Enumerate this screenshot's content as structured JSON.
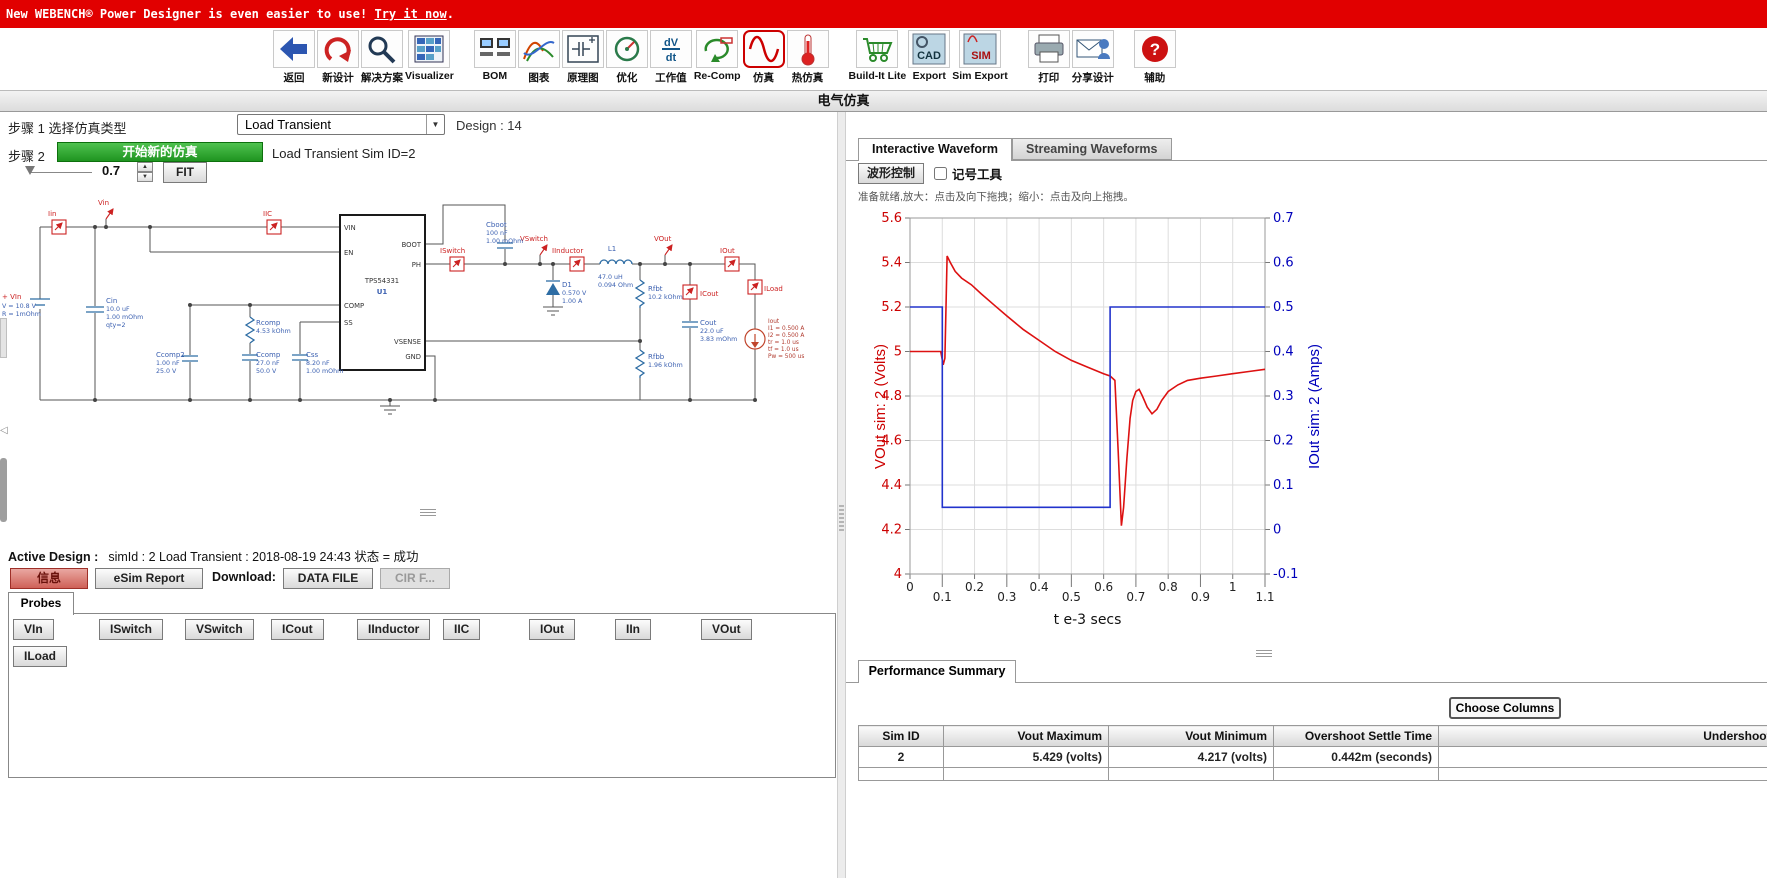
{
  "banner": {
    "prefix": "New WEBENCH® Power Designer is even easier to use! ",
    "link": "Try it now",
    "suffix": "."
  },
  "toolbar": {
    "items": [
      {
        "label": "返回",
        "icon": "back-arrow"
      },
      {
        "label": "新设计",
        "icon": "new-design-arrow"
      },
      {
        "label": "解决方案",
        "icon": "magnifier"
      },
      {
        "label": "Visualizer",
        "icon": "visualizer-grid"
      },
      {
        "label": "BOM",
        "icon": "bom"
      },
      {
        "label": "图表",
        "icon": "charts-curves"
      },
      {
        "label": "原理图",
        "icon": "schematic"
      },
      {
        "label": "优化",
        "icon": "optimize-dial"
      },
      {
        "label": "工作值",
        "icon": "dvdt"
      },
      {
        "label": "Re-Comp",
        "icon": "recomp"
      },
      {
        "label": "仿真",
        "icon": "sine-wave",
        "active": true
      },
      {
        "label": "热仿真",
        "icon": "thermometer"
      },
      {
        "label": "Build-It Lite",
        "icon": "shopping-cart"
      },
      {
        "label": "Export",
        "icon": "cad-export"
      },
      {
        "label": "Sim Export",
        "icon": "sim-export"
      },
      {
        "label": "打印",
        "icon": "printer"
      },
      {
        "label": "分享设计",
        "icon": "share-mail"
      },
      {
        "label": "辅助",
        "icon": "help"
      }
    ]
  },
  "section_bar": {
    "title": "电气仿真"
  },
  "steps": {
    "step1_label": "步骤 1 选择仿真类型",
    "sim_type": "Load Transient",
    "design_label": "Design : 14",
    "step2_label": "步骤 2",
    "start_button": "开始新的仿真",
    "sim_info": "Load Transient Sim ID=2",
    "slider_value": "0.7",
    "fit_button": "FIT"
  },
  "schematic": {
    "ic": {
      "part": "TPS54331",
      "ref": "U1",
      "pins_left": [
        "VIN",
        "EN",
        "COMP",
        "SS"
      ],
      "pins_right": [
        "BOOT",
        "PH",
        "VSENSE",
        "GND"
      ]
    },
    "probes": {
      "iin": "Iin",
      "vin": "Vin",
      "iic": "IIC",
      "iswitch": "ISwitch",
      "vswitch": "VSwitch",
      "iinductor": "IInductor",
      "vout": "VOut",
      "iout": "IOut",
      "icout": "ICout",
      "iload": "ILoad"
    },
    "components": {
      "vin_src": [
        "+ VIn",
        "V = 10.8 V",
        "R = 1mOhm"
      ],
      "cin": [
        "Cin",
        "10.0 uF",
        "1.00 mOhm",
        "qty=2"
      ],
      "ccomp2": [
        "Ccomp2",
        "1.00 nF",
        "25.0 V"
      ],
      "rcomp": [
        "Rcomp",
        "4.53 kOhm"
      ],
      "ccomp": [
        "Ccomp",
        "27.0 nF",
        "50.0 V"
      ],
      "css": [
        "Css",
        "8.20 nF",
        "1.00 mOhm"
      ],
      "cboot": [
        "Cboot",
        "100 nF",
        "1.00 mOhm"
      ],
      "d1": [
        "D1",
        "0.570 V",
        "1.00 A"
      ],
      "l1": [
        "L1",
        "47.0 uH",
        "0.094 Ohm"
      ],
      "rfbt": [
        "Rfbt",
        "10.2 kOhm"
      ],
      "cout": [
        "Cout",
        "22.0 uF",
        "3.83 mOhm"
      ],
      "rfbb": [
        "Rfbb",
        "1.96 kOhm"
      ],
      "iout_src": [
        "Iout",
        "I1 = 0.500 A",
        "I2 = 0.500 A",
        "tr = 1.0 us",
        "tf = 1.0 us",
        "Pw = 500 us"
      ]
    }
  },
  "active_design": {
    "label": "Active Design :",
    "value": "simId : 2 Load Transient : 2018-08-19 24:43 状态 = 成功"
  },
  "actions": {
    "info": "信息",
    "esim_report": "eSim Report",
    "download_label": "Download:",
    "data_file": "DATA FILE",
    "cir_file": "CIR F..."
  },
  "probes_panel": {
    "tab": "Probes",
    "buttons": [
      "VIn",
      "ISwitch",
      "VSwitch",
      "ICout",
      "IInductor",
      "IIC",
      "IOut",
      "IIn",
      "VOut",
      "ILoad"
    ]
  },
  "waveform_panel": {
    "tabs": [
      "Interactive Waveform",
      "Streaming Waveforms"
    ],
    "control_button": "波形控制",
    "marker_checkbox": "记号工具",
    "status_text": "准备就绪,放大：点击及向下拖拽；缩小：点击及向上拖拽。"
  },
  "chart_data": {
    "type": "line",
    "title": "",
    "xlabel": "t e-3 secs",
    "xlim": [
      0,
      1.1
    ],
    "xticks": [
      0,
      0.1,
      0.2,
      0.3,
      0.4,
      0.5,
      0.6,
      0.7,
      0.8,
      0.9,
      1,
      1.1
    ],
    "grid": true,
    "legend": "none",
    "left_axis": {
      "label": "VOut sim: 2 (Volts)",
      "color": "#cc0000",
      "lim": [
        4,
        5.6
      ],
      "ticks": [
        4,
        4.2,
        4.4,
        4.6,
        4.8,
        5,
        5.2,
        5.4,
        5.6
      ]
    },
    "right_axis": {
      "label": "IOut sim: 2 (Amps)",
      "color": "#0000bb",
      "lim": [
        -0.1,
        0.7
      ],
      "ticks": [
        -0.1,
        0,
        0.1,
        0.2,
        0.3,
        0.4,
        0.5,
        0.6,
        0.7
      ]
    },
    "series": [
      {
        "name": "VOut sim: 2",
        "axis": "left",
        "color": "#dd1111",
        "points": [
          [
            0,
            5
          ],
          [
            0.095,
            5
          ],
          [
            0.103,
            4.94
          ],
          [
            0.108,
            4.97
          ],
          [
            0.115,
            5.429
          ],
          [
            0.125,
            5.4
          ],
          [
            0.14,
            5.36
          ],
          [
            0.16,
            5.33
          ],
          [
            0.19,
            5.3
          ],
          [
            0.22,
            5.26
          ],
          [
            0.26,
            5.21
          ],
          [
            0.3,
            5.16
          ],
          [
            0.35,
            5.1
          ],
          [
            0.4,
            5.05
          ],
          [
            0.45,
            5
          ],
          [
            0.5,
            4.96
          ],
          [
            0.55,
            4.93
          ],
          [
            0.6,
            4.9
          ],
          [
            0.62,
            4.89
          ],
          [
            0.635,
            4.87
          ],
          [
            0.645,
            4.55
          ],
          [
            0.655,
            4.217
          ],
          [
            0.662,
            4.3
          ],
          [
            0.672,
            4.52
          ],
          [
            0.682,
            4.7
          ],
          [
            0.69,
            4.78
          ],
          [
            0.7,
            4.82
          ],
          [
            0.71,
            4.83
          ],
          [
            0.72,
            4.8
          ],
          [
            0.735,
            4.75
          ],
          [
            0.75,
            4.72
          ],
          [
            0.765,
            4.74
          ],
          [
            0.78,
            4.78
          ],
          [
            0.8,
            4.82
          ],
          [
            0.83,
            4.85
          ],
          [
            0.86,
            4.87
          ],
          [
            0.9,
            4.88
          ],
          [
            0.95,
            4.89
          ],
          [
            1,
            4.9
          ],
          [
            1.05,
            4.91
          ],
          [
            1.1,
            4.92
          ]
        ]
      },
      {
        "name": "IOut sim: 2",
        "axis": "right",
        "color": "#2233cc",
        "points": [
          [
            0,
            0.5
          ],
          [
            0.1,
            0.5
          ],
          [
            0.1,
            0.05
          ],
          [
            0.62,
            0.05
          ],
          [
            0.62,
            0.5
          ],
          [
            1.1,
            0.5
          ]
        ]
      }
    ]
  },
  "performance": {
    "tab": "Performance Summary",
    "choose_columns": "Choose Columns",
    "columns": [
      "Sim ID",
      "Vout Maximum",
      "Vout Minimum",
      "Overshoot Settle Time",
      "Undershoot Settle Time"
    ],
    "rows": [
      [
        "2",
        "5.429 (volts)",
        "4.217 (volts)",
        "0.442m (seconds)",
        ""
      ]
    ]
  }
}
